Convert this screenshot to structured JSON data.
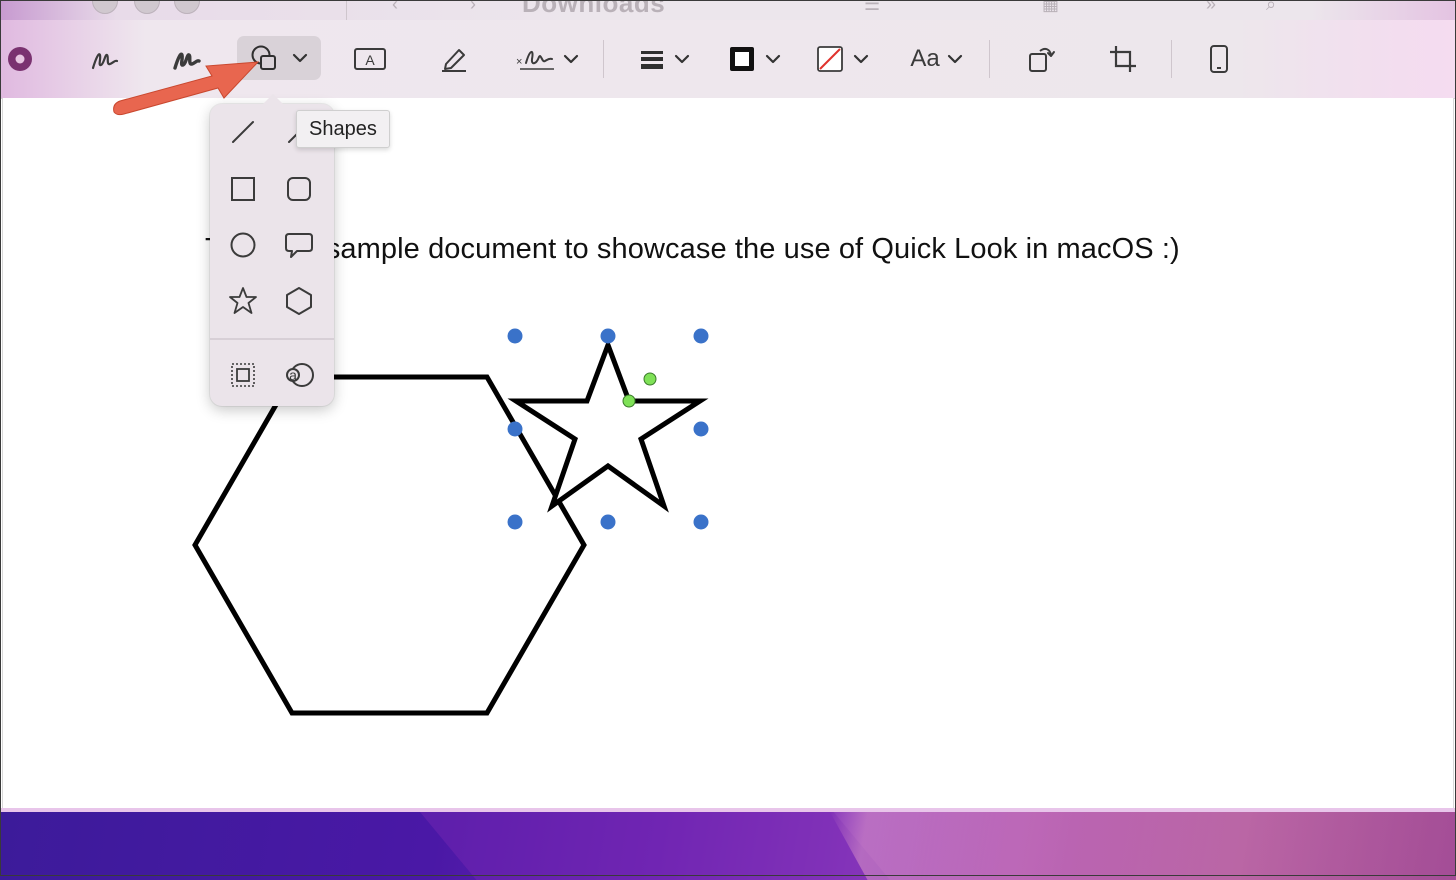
{
  "window": {
    "title": "Downloads"
  },
  "toolbar": {
    "items": [
      {
        "name": "record-icon"
      },
      {
        "name": "sketch-icon"
      },
      {
        "name": "draw-icon"
      },
      {
        "name": "shapes-icon",
        "active": true
      },
      {
        "name": "text-box-icon"
      },
      {
        "name": "highlight-icon"
      },
      {
        "name": "signature-icon"
      },
      {
        "name": "shape-style-icon"
      },
      {
        "name": "border-color-icon"
      },
      {
        "name": "fill-color-icon"
      },
      {
        "name": "text-style-icon",
        "label": "Aa"
      },
      {
        "name": "rotate-icon"
      },
      {
        "name": "crop-icon"
      },
      {
        "name": "device-icon"
      }
    ]
  },
  "tooltip": {
    "text": "Shapes"
  },
  "shapes_popover": {
    "items": [
      "line-icon",
      "arrow-icon",
      "rectangle-icon",
      "rounded-rectangle-icon",
      "oval-icon",
      "speech-bubble-icon",
      "star-icon",
      "polygon-icon",
      "mask-icon",
      "loupe-icon"
    ]
  },
  "document": {
    "text_start": "T",
    "text": "sample document to showcase the use of Quick Look in macOS :)"
  },
  "colors": {
    "selection_handle": "#3a72c9",
    "rotation_handle": "#7fe157",
    "arrow": "#e8664f",
    "popover_bg": "#ebe4ea"
  }
}
